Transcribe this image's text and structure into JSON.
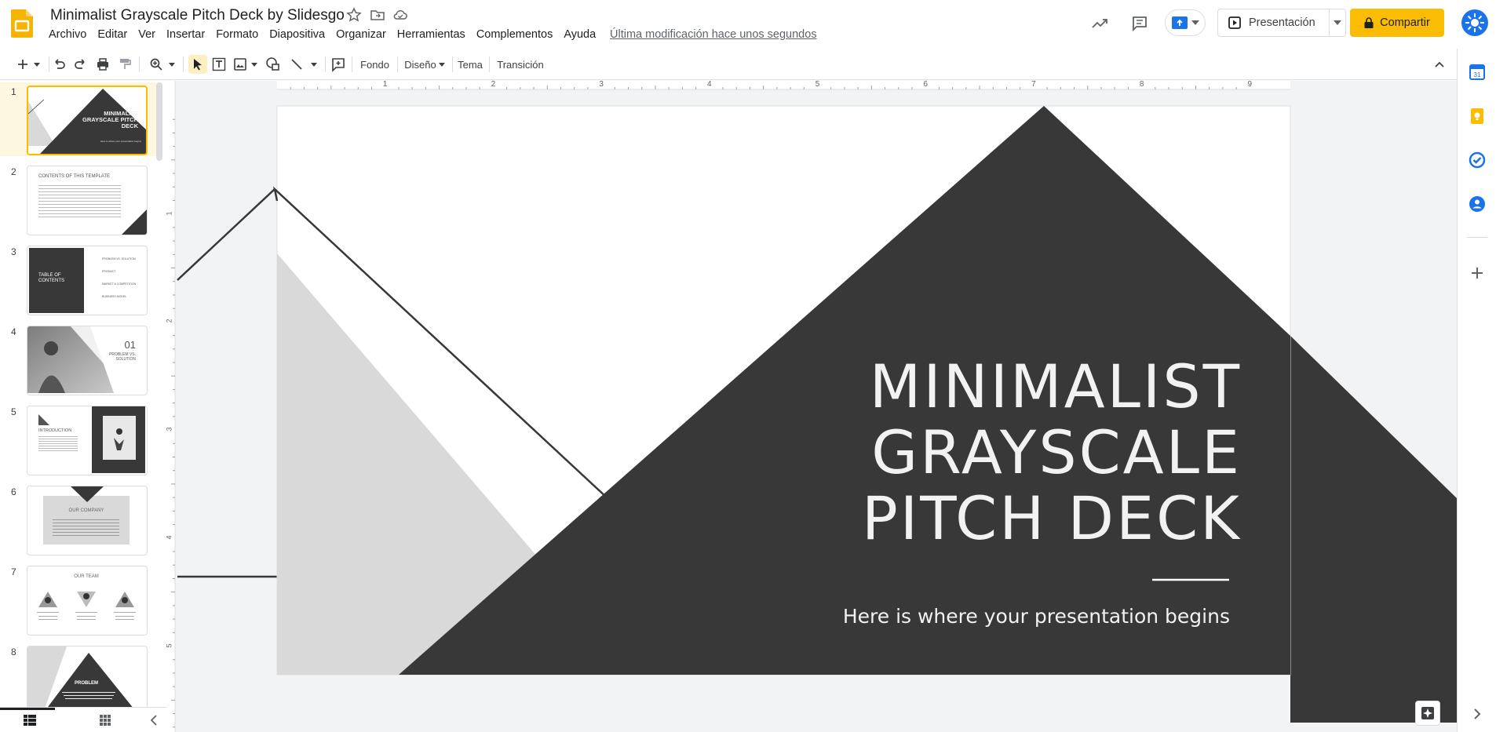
{
  "app": {
    "title": "Minimalist Grayscale Pitch Deck by Slidesgo",
    "last_edit": "Última modificación hace unos segundos",
    "icons": [
      "slides-logo",
      "star-icon",
      "move-folder-icon",
      "cloud-status-icon",
      "activity-trend-icon",
      "comments-icon",
      "meet-present-icon",
      "present-icon",
      "lock-icon"
    ]
  },
  "menu": [
    "Archivo",
    "Editar",
    "Ver",
    "Insertar",
    "Formato",
    "Diapositiva",
    "Organizar",
    "Herramientas",
    "Complementos",
    "Ayuda"
  ],
  "header": {
    "present_label": "Presentación",
    "share_label": "Compartir"
  },
  "toolbar": {
    "background_label": "Fondo",
    "layout_label": "Diseño",
    "theme_label": "Tema",
    "transition_label": "Transición",
    "icons": [
      "new-slide-icon",
      "undo-icon",
      "redo-icon",
      "print-icon",
      "paint-format-icon",
      "zoom-icon",
      "select-icon",
      "textbox-icon",
      "image-icon",
      "shape-icon",
      "line-icon",
      "comment-add-icon",
      "collapse-icon"
    ]
  },
  "ruler": {
    "h_ticks": [
      "1",
      "2",
      "3",
      "4",
      "5",
      "6",
      "7",
      "8",
      "9"
    ],
    "v_ticks": [
      "1",
      "2",
      "3",
      "4",
      "5"
    ]
  },
  "slide": {
    "title_lines": [
      "MINIMALIST",
      "GRAYSCALE",
      "PITCH DECK"
    ],
    "subtitle": "Here is where your presentation begins"
  },
  "thumbnails": [
    {
      "num": "1",
      "title": "MINIMALIST GRAYSCALE PITCH DECK",
      "sub": "Here is where your presentation begins"
    },
    {
      "num": "2",
      "title": "CONTENTS OF THIS TEMPLATE"
    },
    {
      "num": "3",
      "title": "TABLE OF CONTENTS",
      "items": [
        "PROBLEM VS. SOLUTION",
        "PRODUCT",
        "MARKET & COMPETITION",
        "BUSINESS MODEL"
      ]
    },
    {
      "num": "4",
      "title": "01",
      "sub": "PROBLEM VS. SOLUTION"
    },
    {
      "num": "5",
      "title": "INTRODUCTION"
    },
    {
      "num": "6",
      "title": "OUR COMPANY"
    },
    {
      "num": "7",
      "title": "OUR TEAM"
    },
    {
      "num": "8",
      "title": "PROBLEM"
    }
  ],
  "side_panel": {
    "icons": [
      "calendar-icon",
      "keep-icon",
      "tasks-icon",
      "contacts-icon",
      "add-icon",
      "expand-icon"
    ]
  },
  "bottom": {
    "icons": [
      "filmstrip-view-icon",
      "grid-view-icon",
      "collapse-panel-icon",
      "explore-icon"
    ]
  },
  "colors": {
    "accent": "#fbbc04",
    "slide_dark": "#383838",
    "slide_light": "#d9d9d9",
    "blue": "#1a73e8"
  }
}
